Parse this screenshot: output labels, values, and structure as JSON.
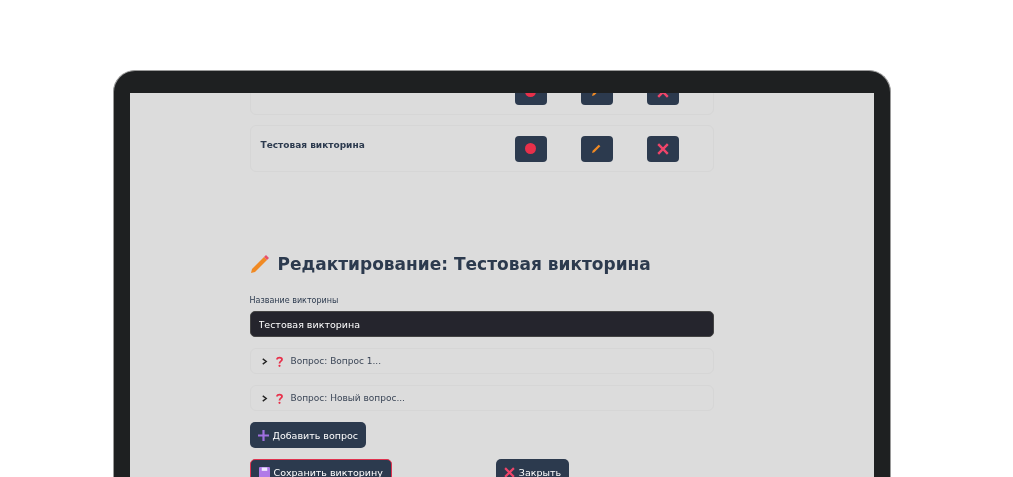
{
  "quiz_list": [
    {
      "kind": "partial"
    },
    {
      "kind": "full",
      "title": "Тестовая викторина"
    }
  ],
  "editor": {
    "heading": "Редактирование: Тестовая викторина",
    "name_label": "Название викторины",
    "name_value": "Тестовая викторина",
    "questions": [
      {
        "label": "Вопрос: Вопрос 1...",
        "expanded": false
      },
      {
        "label": "Вопрос: Новый вопрос...",
        "expanded": false
      }
    ],
    "add_button": "Добавить вопрос",
    "save_button": "Сохранить викторину",
    "close_button": "Закрыть"
  }
}
